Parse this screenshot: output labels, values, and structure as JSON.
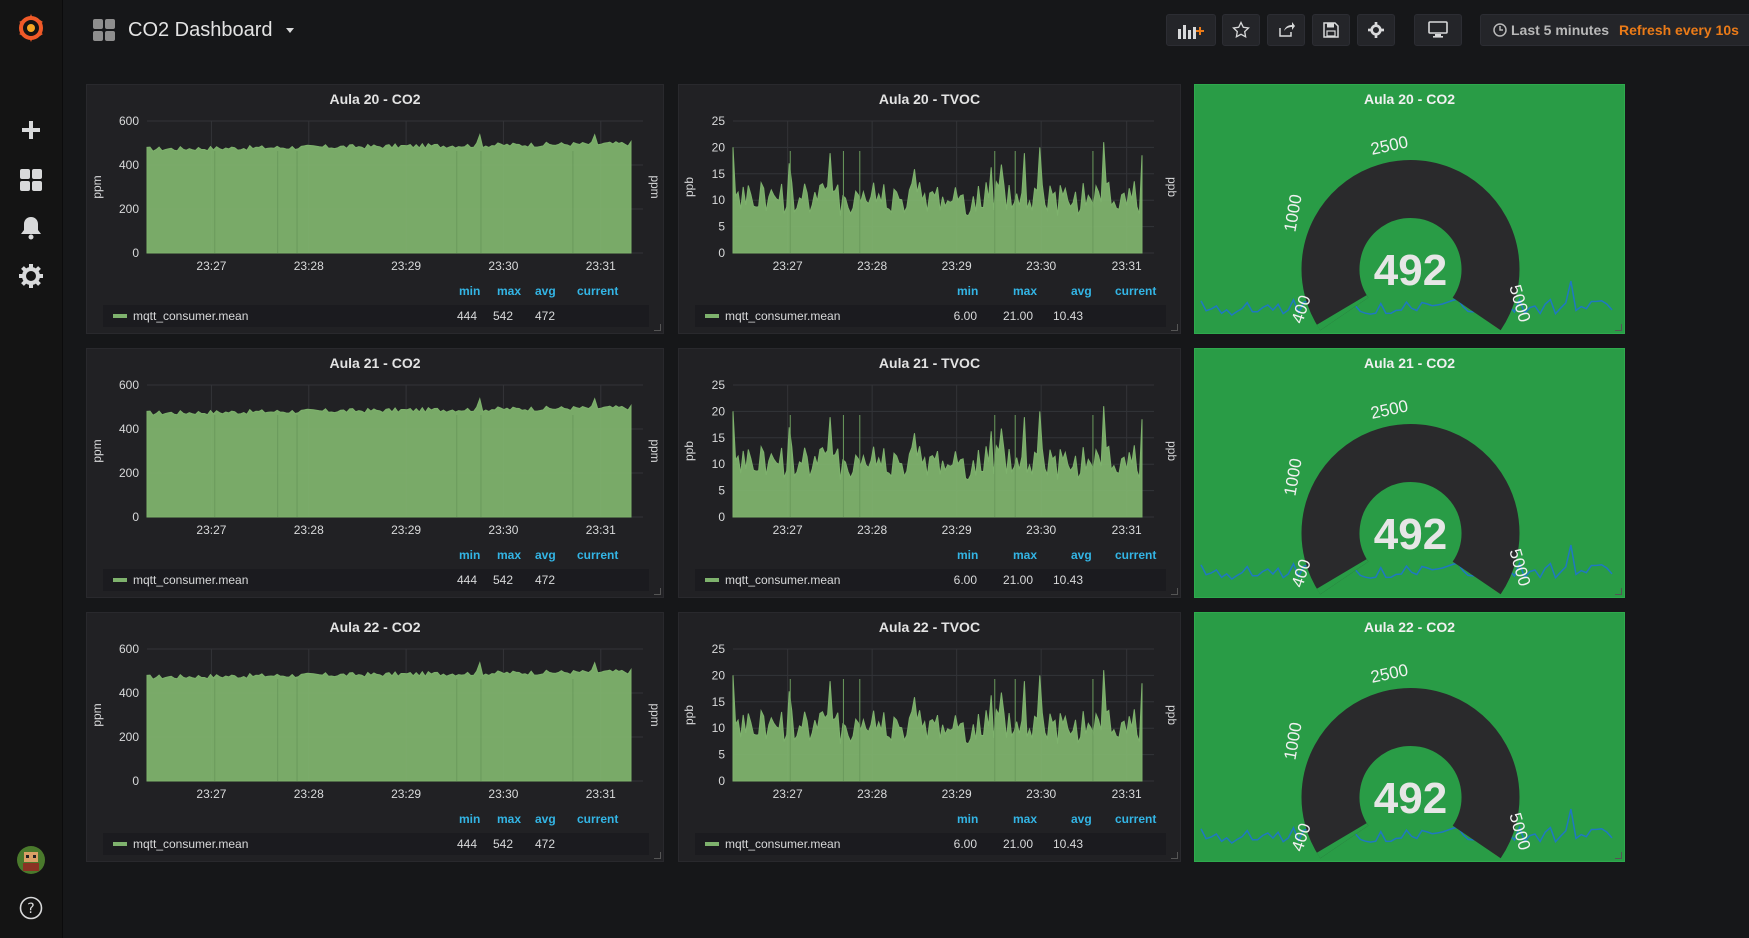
{
  "dashboard": {
    "title": "CO2 Dashboard"
  },
  "toolbar": {
    "add_panel_icon": "add-panel-icon",
    "star_icon": "star-icon",
    "share_icon": "share-icon",
    "save_icon": "save-icon",
    "settings_icon": "gear-icon",
    "tv_icon": "monitor-icon"
  },
  "timepicker": {
    "range": "Last 5 minutes",
    "refresh": "Refresh every 10s"
  },
  "sidemenu": {
    "items": [
      {
        "name": "create",
        "icon": "plus-icon"
      },
      {
        "name": "dashboards",
        "icon": "grid-icon"
      },
      {
        "name": "alerting",
        "icon": "bell-icon"
      },
      {
        "name": "configuration",
        "icon": "gear-icon"
      }
    ],
    "bottom": [
      {
        "name": "profile",
        "icon": "avatar"
      },
      {
        "name": "help",
        "icon": "question-icon"
      }
    ]
  },
  "colors": {
    "graph_fill": "#7eb26d",
    "gauge_bg": "#299c46",
    "accent": "#eb7b18",
    "legend_head": "#33b5e5"
  },
  "time_labels": [
    "23:27",
    "23:28",
    "23:29",
    "23:30",
    "23:31"
  ],
  "legend_headers": {
    "min": "min",
    "max": "max",
    "avg": "avg",
    "current": "current"
  },
  "rows": [
    {
      "co2": {
        "title": "Aula 20 - CO2",
        "unit_left": "ppm",
        "unit_right": "ppm",
        "y_ticks": [
          "600",
          "400",
          "200",
          "0"
        ],
        "series": "mqtt_consumer.mean",
        "min": "444",
        "max": "542",
        "avg": "472",
        "current": ""
      },
      "tvoc": {
        "title": "Aula 20 - TVOC",
        "unit_left": "ppb",
        "unit_right": "ppb",
        "y_ticks": [
          "25",
          "20",
          "15",
          "10",
          "5",
          "0"
        ],
        "series": "mqtt_consumer.mean",
        "min": "6.00",
        "max": "21.00",
        "avg": "10.43",
        "current": ""
      },
      "gauge": {
        "title": "Aula 20 - CO2",
        "value": "492",
        "thresholds": [
          "400",
          "1000",
          "2500",
          "5000"
        ]
      }
    },
    {
      "co2": {
        "title": "Aula 21 - CO2",
        "unit_left": "ppm",
        "unit_right": "ppm",
        "y_ticks": [
          "600",
          "400",
          "200",
          "0"
        ],
        "series": "mqtt_consumer.mean",
        "min": "444",
        "max": "542",
        "avg": "472",
        "current": ""
      },
      "tvoc": {
        "title": "Aula 21 - TVOC",
        "unit_left": "ppb",
        "unit_right": "ppb",
        "y_ticks": [
          "25",
          "20",
          "15",
          "10",
          "5",
          "0"
        ],
        "series": "mqtt_consumer.mean",
        "min": "6.00",
        "max": "21.00",
        "avg": "10.43",
        "current": ""
      },
      "gauge": {
        "title": "Aula 21 - CO2",
        "value": "492",
        "thresholds": [
          "400",
          "1000",
          "2500",
          "5000"
        ]
      }
    },
    {
      "co2": {
        "title": "Aula 22 - CO2",
        "unit_left": "ppm",
        "unit_right": "ppm",
        "y_ticks": [
          "600",
          "400",
          "200",
          "0"
        ],
        "series": "mqtt_consumer.mean",
        "min": "444",
        "max": "542",
        "avg": "472",
        "current": ""
      },
      "tvoc": {
        "title": "Aula 22 - TVOC",
        "unit_left": "ppb",
        "unit_right": "ppb",
        "y_ticks": [
          "25",
          "20",
          "15",
          "10",
          "5",
          "0"
        ],
        "series": "mqtt_consumer.mean",
        "min": "6.00",
        "max": "21.00",
        "avg": "10.43",
        "current": ""
      },
      "gauge": {
        "title": "Aula 22 - CO2",
        "value": "492",
        "thresholds": [
          "400",
          "1000",
          "2500",
          "5000"
        ]
      }
    }
  ]
}
